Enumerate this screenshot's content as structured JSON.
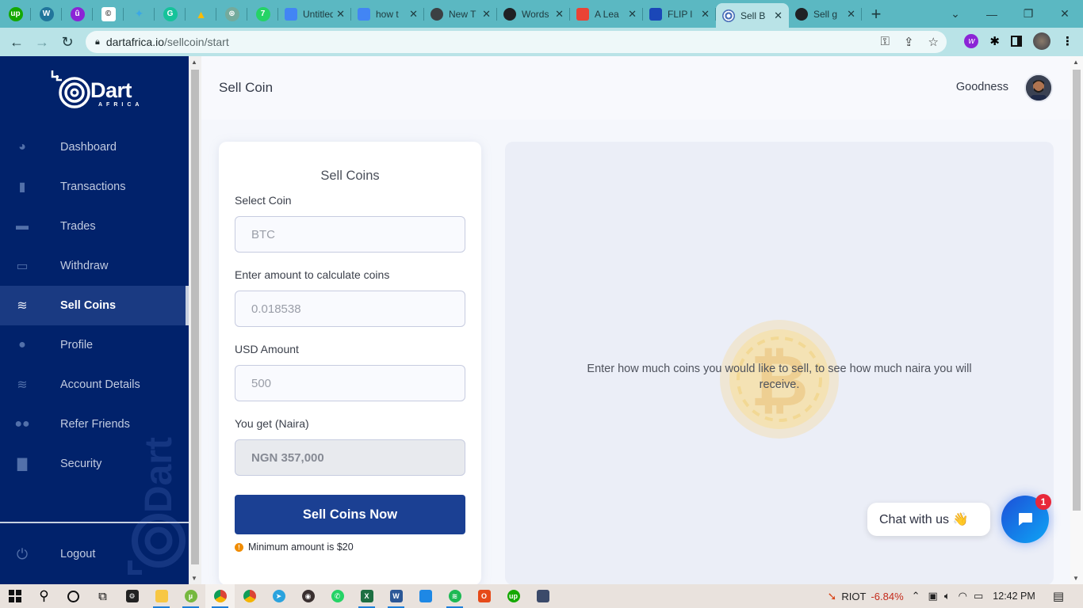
{
  "browser": {
    "pinned_tabs": [
      {
        "name": "upwork",
        "glyph": "up",
        "color": "#14a800"
      },
      {
        "name": "wordpress",
        "glyph": "W",
        "color": "#21759b"
      },
      {
        "name": "ublock",
        "glyph": "û",
        "color": "#8b24d6"
      },
      {
        "name": "copyright",
        "glyph": "©",
        "color": "#ffffff"
      },
      {
        "name": "hummingbird",
        "glyph": "✦",
        "color": "#3ba7e6"
      },
      {
        "name": "grammarly",
        "glyph": "G",
        "color": "#15c39a"
      },
      {
        "name": "google-drive",
        "glyph": "▲",
        "color": "#fbbc04"
      },
      {
        "name": "openai",
        "glyph": "⊛",
        "color": "#74aa9c"
      },
      {
        "name": "whatsapp-7",
        "glyph": "7",
        "color": "#25d366"
      }
    ],
    "tabs": [
      {
        "title": "Untitled",
        "icon": "docs-icon",
        "color": "#4285f4"
      },
      {
        "title": "how t",
        "icon": "docs-icon",
        "color": "#4285f4"
      },
      {
        "title": "New T",
        "icon": "chrome-icon",
        "color": "#3c4043"
      },
      {
        "title": "Words",
        "icon": "globe-icon",
        "color": "#202124"
      },
      {
        "title": "A Lea",
        "icon": "gmail-icon",
        "color": "#ea4335"
      },
      {
        "title": "FLIP l",
        "icon": "flip-icon",
        "color": "#1a47b8"
      },
      {
        "title": "Sell B",
        "icon": "dart-icon",
        "color": "#4a6fb8",
        "active": true
      },
      {
        "title": "Sell g",
        "icon": "globe-icon",
        "color": "#202124"
      }
    ],
    "new_tab": "+",
    "window_controls": {
      "dropdown": "⌄",
      "minimize": "—",
      "restore": "❐",
      "close": "✕"
    },
    "url_host": "dartafrica.io",
    "url_path": "/sellcoin/start"
  },
  "sidebar": {
    "brand": "Dart",
    "brand_sub": "AFRICA",
    "items": [
      {
        "label": "Dashboard",
        "icon": "pie-chart-icon",
        "glyph": "◕"
      },
      {
        "label": "Transactions",
        "icon": "file-icon",
        "glyph": "▮"
      },
      {
        "label": "Trades",
        "icon": "briefcase-icon",
        "glyph": "▬"
      },
      {
        "label": "Withdraw",
        "icon": "card-icon",
        "glyph": "▭"
      },
      {
        "label": "Sell Coins",
        "icon": "coins-icon",
        "glyph": "≋",
        "active": true
      },
      {
        "label": "Profile",
        "icon": "user-icon",
        "glyph": "●"
      },
      {
        "label": "Account Details",
        "icon": "layers-icon",
        "glyph": "≋"
      },
      {
        "label": "Refer Friends",
        "icon": "users-icon",
        "glyph": "●●"
      },
      {
        "label": "Security",
        "icon": "lock-icon",
        "glyph": "▇"
      }
    ],
    "logout": {
      "label": "Logout",
      "icon": "power-icon",
      "glyph": "⏻"
    }
  },
  "header": {
    "page_title": "Sell Coin",
    "user_name": "Goodness"
  },
  "form": {
    "title": "Sell Coins",
    "select_coin_label": "Select Coin",
    "select_coin_value": "BTC",
    "amount_label": "Enter amount to calculate coins",
    "amount_value": "0.018538",
    "usd_label": "USD Amount",
    "usd_value": "500",
    "naira_label": "You get (Naira)",
    "naira_value": "NGN 357,000",
    "submit_label": "Sell Coins Now",
    "min_note": "Minimum amount is $20",
    "min_note_icon": "!"
  },
  "result": {
    "message": "Enter how much coins you would like to sell, to see how much naira you will receive.",
    "coin_glyph": "₿"
  },
  "chat": {
    "label": "Chat with us 👋",
    "badge_count": "1"
  },
  "taskbar": {
    "apps": [
      "start",
      "search",
      "cortana",
      "task-view",
      "pes",
      "file-explorer",
      "utorrent",
      "chrome-active",
      "chrome",
      "telegram",
      "music",
      "whatsapp",
      "excel",
      "word",
      "store",
      "spotify",
      "office",
      "upwork",
      "game"
    ],
    "ticker_symbol": "RIOT",
    "ticker_change": "-6.84%",
    "ticker_color": "#c42b1c",
    "time": "12:42 PM"
  }
}
